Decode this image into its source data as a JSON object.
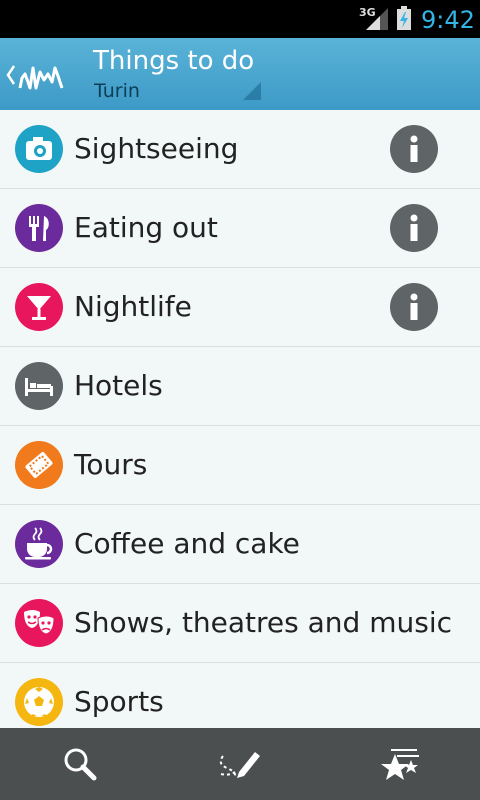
{
  "status_bar": {
    "network": "3G",
    "time": "9:42"
  },
  "header": {
    "title": "Things to do",
    "subtitle": "Turin"
  },
  "categories": [
    {
      "label": "Sightseeing",
      "icon": "camera-icon",
      "color": "#1ea3c6",
      "info": true
    },
    {
      "label": "Eating out",
      "icon": "fork-knife-icon",
      "color": "#6c2b9c",
      "info": true
    },
    {
      "label": "Nightlife",
      "icon": "cocktail-icon",
      "color": "#e8175d",
      "info": true
    },
    {
      "label": "Hotels",
      "icon": "bed-icon",
      "color": "#5f6566",
      "info": false
    },
    {
      "label": "Tours",
      "icon": "ticket-icon",
      "color": "#f07a1c",
      "info": false
    },
    {
      "label": "Coffee and cake",
      "icon": "coffee-cup-icon",
      "color": "#6c2b9c",
      "info": false
    },
    {
      "label": "Shows, theatres and music",
      "icon": "theater-masks-icon",
      "color": "#e8175d",
      "info": false
    },
    {
      "label": "Sports",
      "icon": "soccer-ball-icon",
      "color": "#f5b70f",
      "info": false
    }
  ],
  "bottom_bar": {
    "items": [
      "search-icon",
      "route-pencil-icon",
      "favorites-stars-icon"
    ]
  }
}
